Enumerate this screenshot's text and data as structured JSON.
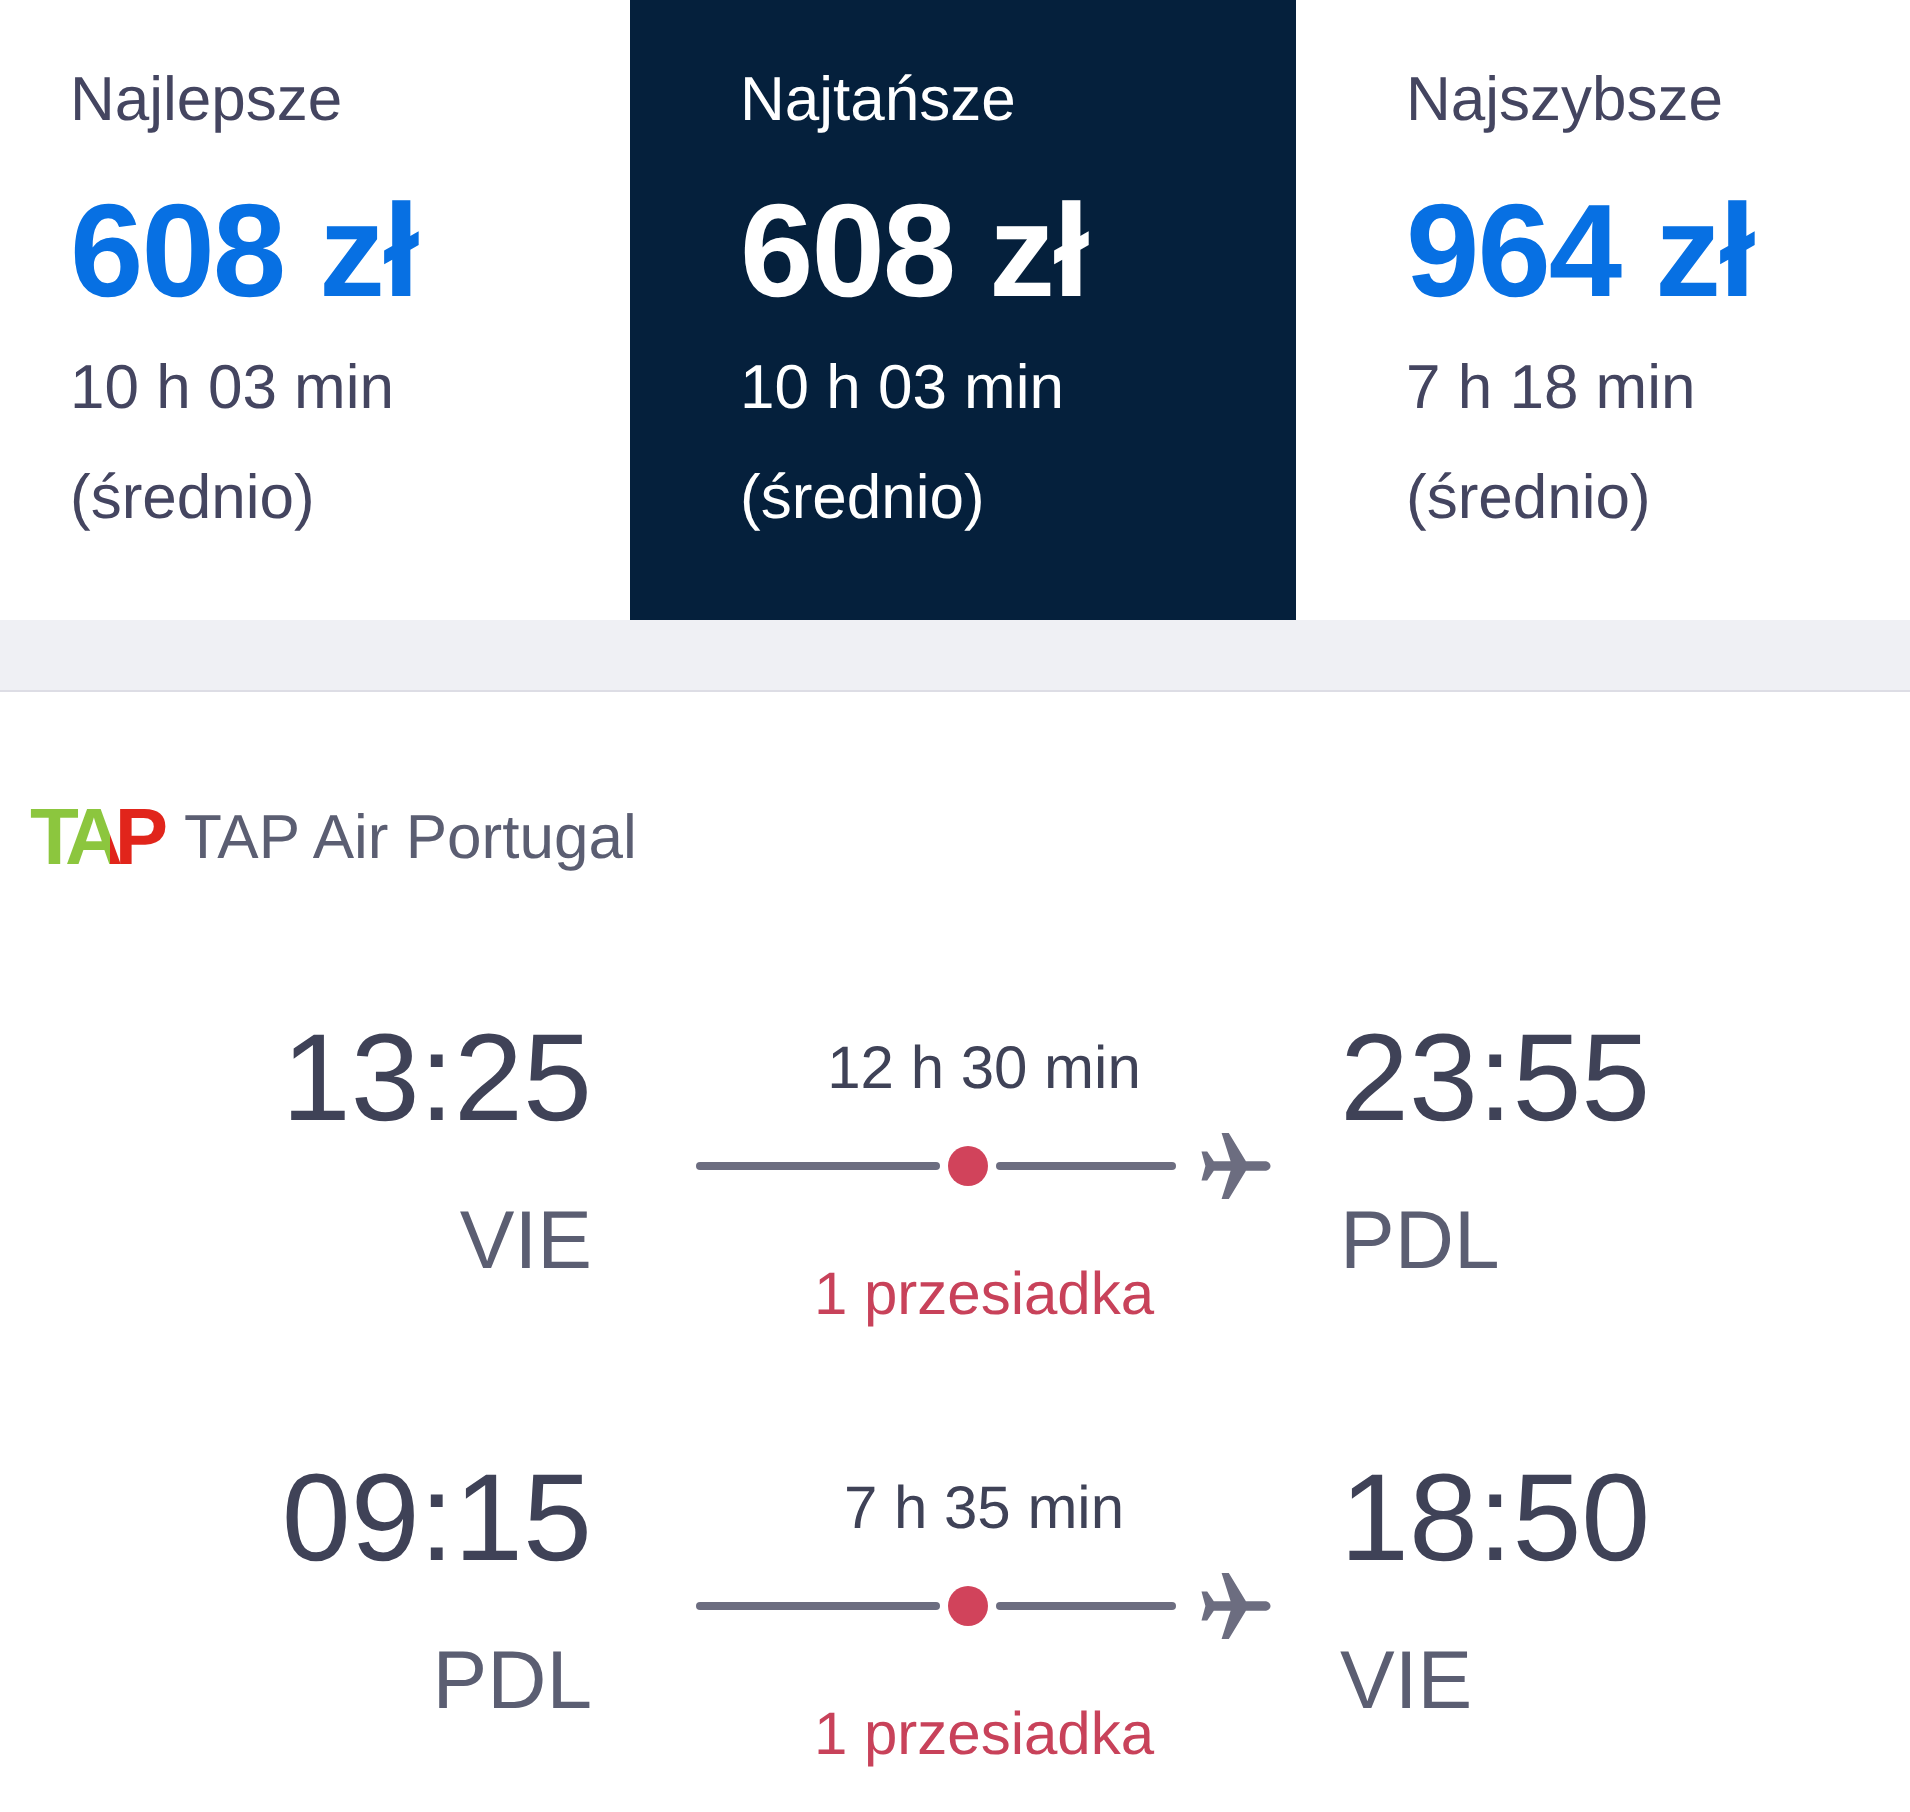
{
  "sort_tabs": [
    {
      "label": "Najlepsze",
      "price": "608 zł",
      "duration": "10 h 03 min",
      "note": "(średnio)",
      "selected": false
    },
    {
      "label": "Najtańsze",
      "price": "608 zł",
      "duration": "10 h 03 min",
      "note": "(średnio)",
      "selected": true
    },
    {
      "label": "Najszybsze",
      "price": "964 zł",
      "duration": "7 h 18 min",
      "note": "(średnio)",
      "selected": false
    }
  ],
  "result": {
    "airline": {
      "logo": "TAP",
      "name": "TAP Air Portugal"
    },
    "legs": [
      {
        "depart_time": "13:25",
        "depart_airport": "VIE",
        "duration": "12 h 30 min",
        "stops": "1 przesiadka",
        "arrive_time": "23:55",
        "arrive_airport": "PDL"
      },
      {
        "depart_time": "09:15",
        "depart_airport": "PDL",
        "duration": "7 h 35 min",
        "stops": "1 przesiadka",
        "arrive_time": "18:50",
        "arrive_airport": "VIE"
      }
    ]
  }
}
